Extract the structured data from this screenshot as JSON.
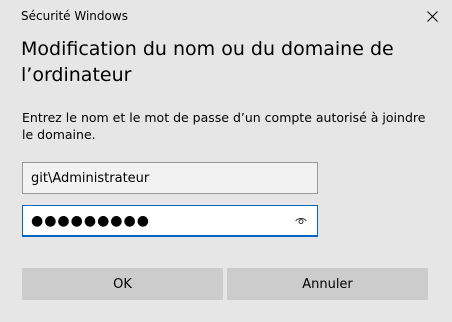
{
  "window": {
    "title": "Sécurité Windows",
    "close_icon": "close-icon"
  },
  "dialog": {
    "heading": "Modification du nom ou du domaine de l’ordinateur",
    "instructions": "Entrez le nom et le mot de passe d’un compte autorisé à joindre le domaine."
  },
  "form": {
    "username_value": "git\\Administrateur",
    "password_masked": "●●●●●●●●●",
    "password_reveal_icon": "eye-icon"
  },
  "buttons": {
    "ok_label": "OK",
    "cancel_label": "Annuler"
  },
  "colors": {
    "background": "#e6e6e6",
    "focus_accent": "#0067c0",
    "button_bg": "#cccccc"
  }
}
